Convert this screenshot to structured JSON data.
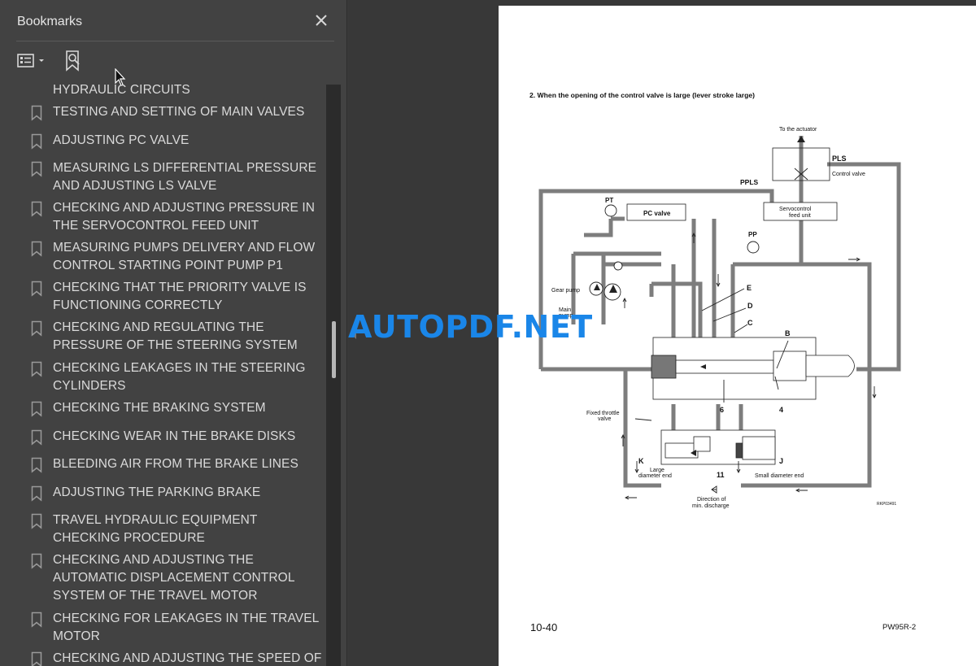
{
  "panel": {
    "title": "Bookmarks",
    "close_icon": "close-icon",
    "options_icon": "bookmark-options-icon",
    "find_icon": "find-current-bookmark-icon"
  },
  "bookmarks": [
    {
      "label": "HYDRAULIC CIRCUITS"
    },
    {
      "label": "TESTING AND SETTING OF MAIN VALVES"
    },
    {
      "label": "ADJUSTING PC VALVE"
    },
    {
      "label": "MEASURING LS DIFFERENTIAL PRESSURE AND ADJUSTING LS VALVE"
    },
    {
      "label": "CHECKING AND ADJUSTING PRESSURE IN THE SERVOCONTROL FEED UNIT"
    },
    {
      "label": "MEASURING PUMPS DELIVERY AND FLOW CONTROL STARTING POINT PUMP P1"
    },
    {
      "label": "CHECKING THAT THE PRIORITY VALVE IS FUNCTIONING CORRECTLY"
    },
    {
      "label": "CHECKING AND REGULATING THE PRESSURE OF THE STEERING SYSTEM"
    },
    {
      "label": "CHECKING LEAKAGES IN THE STEERING CYLINDERS"
    },
    {
      "label": "CHECKING THE BRAKING SYSTEM"
    },
    {
      "label": "CHECKING WEAR IN THE BRAKE DISKS"
    },
    {
      "label": "BLEEDING AIR FROM THE BRAKE LINES"
    },
    {
      "label": "ADJUSTING THE PARKING BRAKE"
    },
    {
      "label": "TRAVEL HYDRAULIC EQUIPMENT CHECKING PROCEDURE"
    },
    {
      "label": "CHECKING AND ADJUSTING THE AUTOMATIC DISPLACEMENT CONTROL SYSTEM OF THE TRAVEL MOTOR"
    },
    {
      "label": "CHECKING FOR LEAKAGES IN THE TRAVEL MOTOR"
    },
    {
      "label": "CHECKING AND ADJUSTING THE SPEED OF THE"
    }
  ],
  "document": {
    "caption": "2.  When the opening of the control valve is large (lever stroke large)",
    "page_number": "10-40",
    "model": "PW95R-2",
    "diagram_labels": {
      "to_actuator": "To the actuator",
      "pls": "PLS",
      "control_valve": "Control valve",
      "ppls": "PPLS",
      "pt": "PT",
      "pc_valve": "PC valve",
      "servo_1": "Servocontrol",
      "servo_2": "feed unit",
      "pp": "PP",
      "gear_pump": "Gear pump",
      "main_pump_1": "Main",
      "main_pump_2": "pump",
      "e": "E",
      "d": "D",
      "c": "C",
      "b": "B",
      "six": "6",
      "four": "4",
      "fixed_1": "Fixed throttle",
      "fixed_2": "valve",
      "k": "K",
      "j": "J",
      "large_1": "Large",
      "large_2": "diameter end",
      "eleven": "11",
      "small": "Small diameter end",
      "direction_1": "Direction of",
      "direction_2": "min. discharge",
      "ref": "RKP03491"
    }
  },
  "watermark": "AUTOPDF.NET",
  "colors": {
    "panel_bg": "#424242",
    "viewer_bg": "#383838",
    "watermark": "#1a86e8"
  }
}
